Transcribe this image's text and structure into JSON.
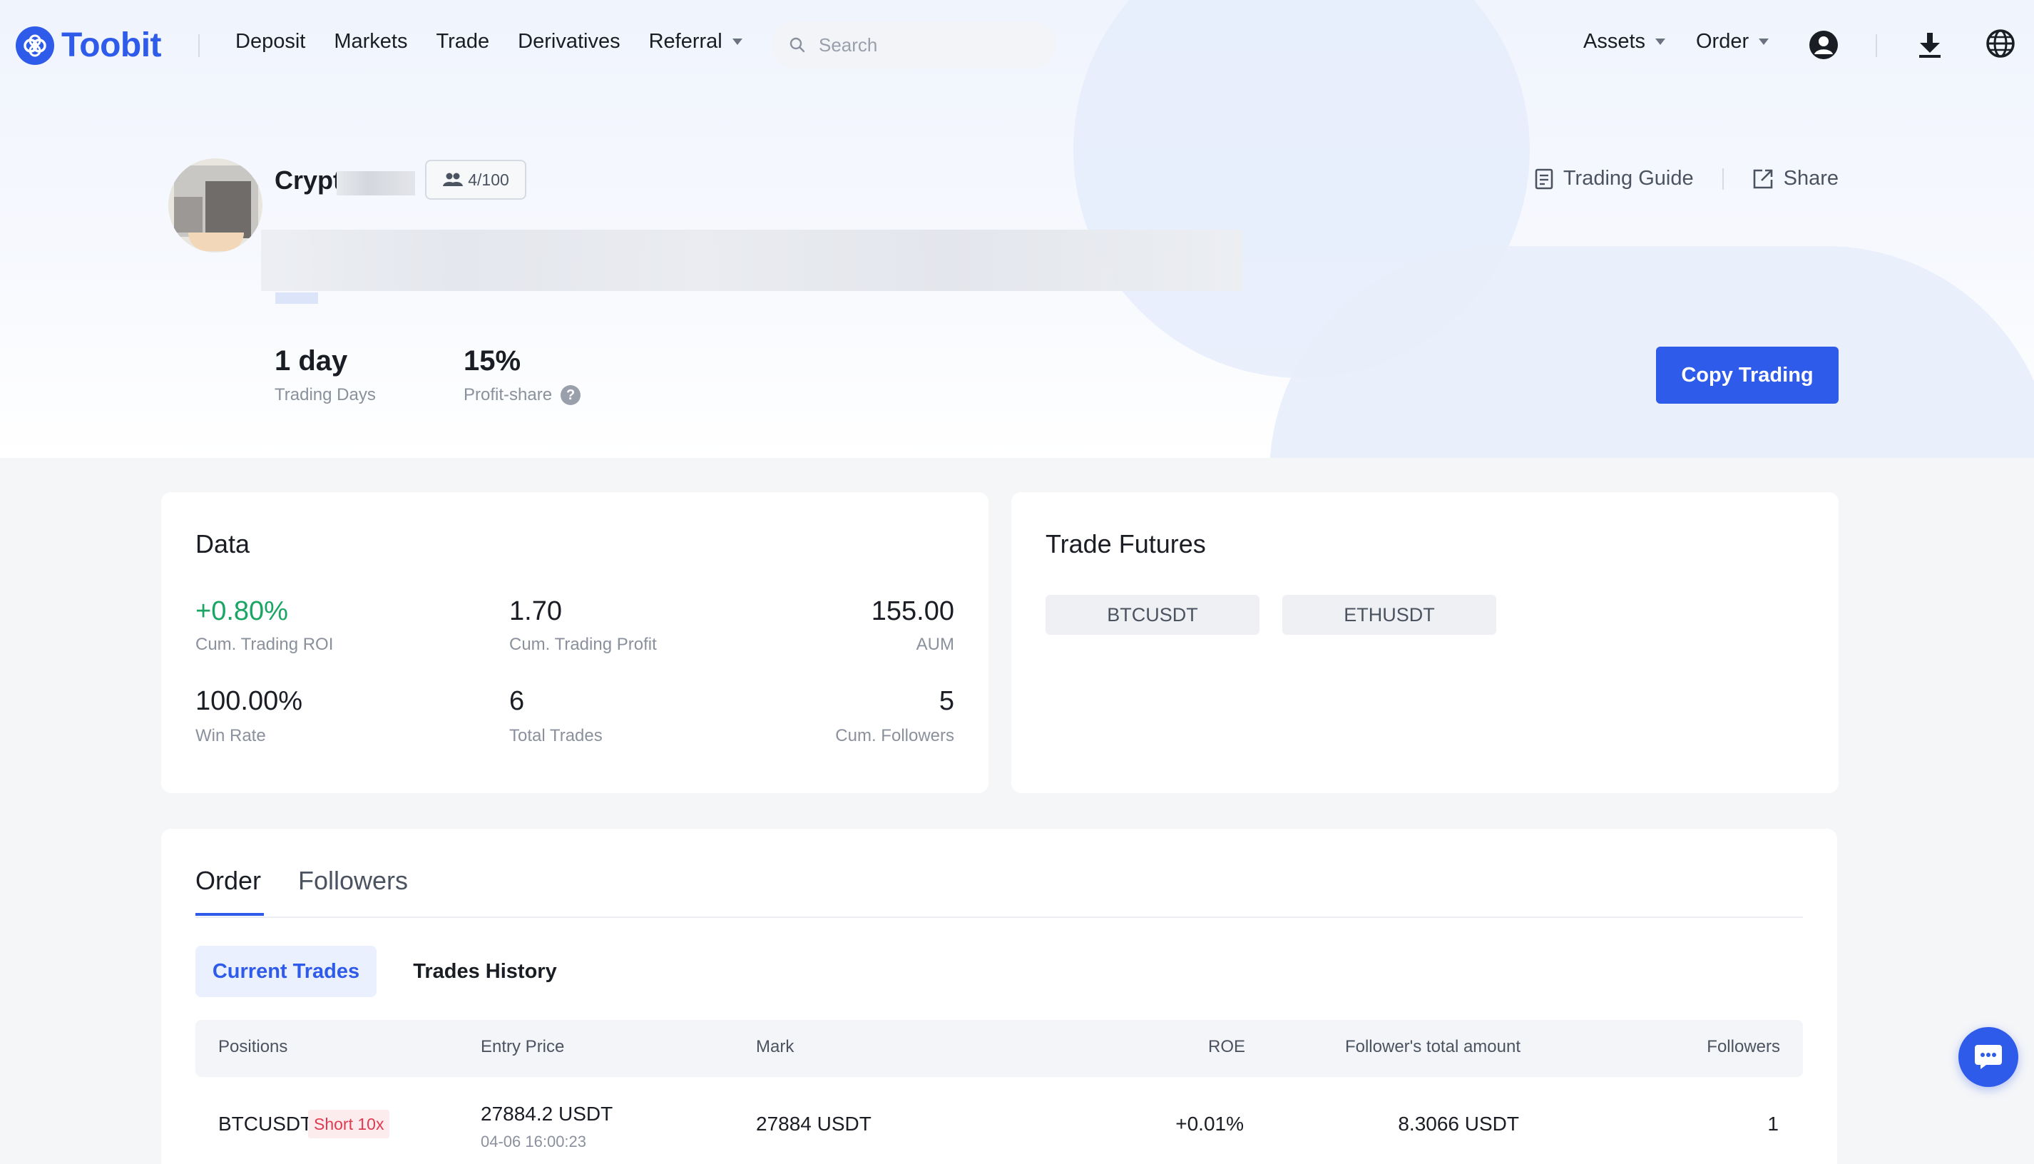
{
  "brand": {
    "name": "Toobit",
    "accent": "#2f5bea"
  },
  "nav": {
    "links": [
      "Deposit",
      "Markets",
      "Trade",
      "Derivatives",
      "Referral"
    ],
    "search_placeholder": "Search",
    "assets": "Assets",
    "order": "Order",
    "icons": [
      "user-icon",
      "download-icon",
      "globe-icon"
    ]
  },
  "profile": {
    "name": "Crypto",
    "followers_badge": "4/100",
    "trading_guide": "Trading Guide",
    "share": "Share",
    "trading_days_value": "1 day",
    "trading_days_label": "Trading Days",
    "profit_share_value": "15%",
    "profit_share_label": "Profit-share",
    "copy_button": "Copy Trading"
  },
  "data_card": {
    "title": "Data",
    "metrics": [
      {
        "value": "+0.80%",
        "label": "Cum. Trading ROI"
      },
      {
        "value": "1.70",
        "label": "Cum. Trading Profit"
      },
      {
        "value": "155.00",
        "label": "AUM"
      },
      {
        "value": "100.00%",
        "label": "Win Rate"
      },
      {
        "value": "6",
        "label": "Total Trades"
      },
      {
        "value": "5",
        "label": "Cum. Followers"
      }
    ]
  },
  "futures_card": {
    "title": "Trade Futures",
    "pairs": [
      "BTCUSDT",
      "ETHUSDT"
    ]
  },
  "orders": {
    "tabs": [
      "Order",
      "Followers"
    ],
    "active_tab": "Order",
    "subtabs": [
      "Current Trades",
      "Trades History"
    ],
    "active_subtab": "Current Trades",
    "columns": [
      "Positions",
      "Entry Price",
      "Mark",
      "ROE",
      "Follower's total amount",
      "Followers"
    ],
    "rows": [
      {
        "position": "BTCUSDT",
        "side_tag": "Short 10x",
        "entry_price": "27884.2 USDT",
        "entry_time": "04-06 16:00:23",
        "mark": "27884 USDT",
        "roe": "+0.01%",
        "follower_total": "8.3066 USDT",
        "followers": "1"
      }
    ]
  }
}
